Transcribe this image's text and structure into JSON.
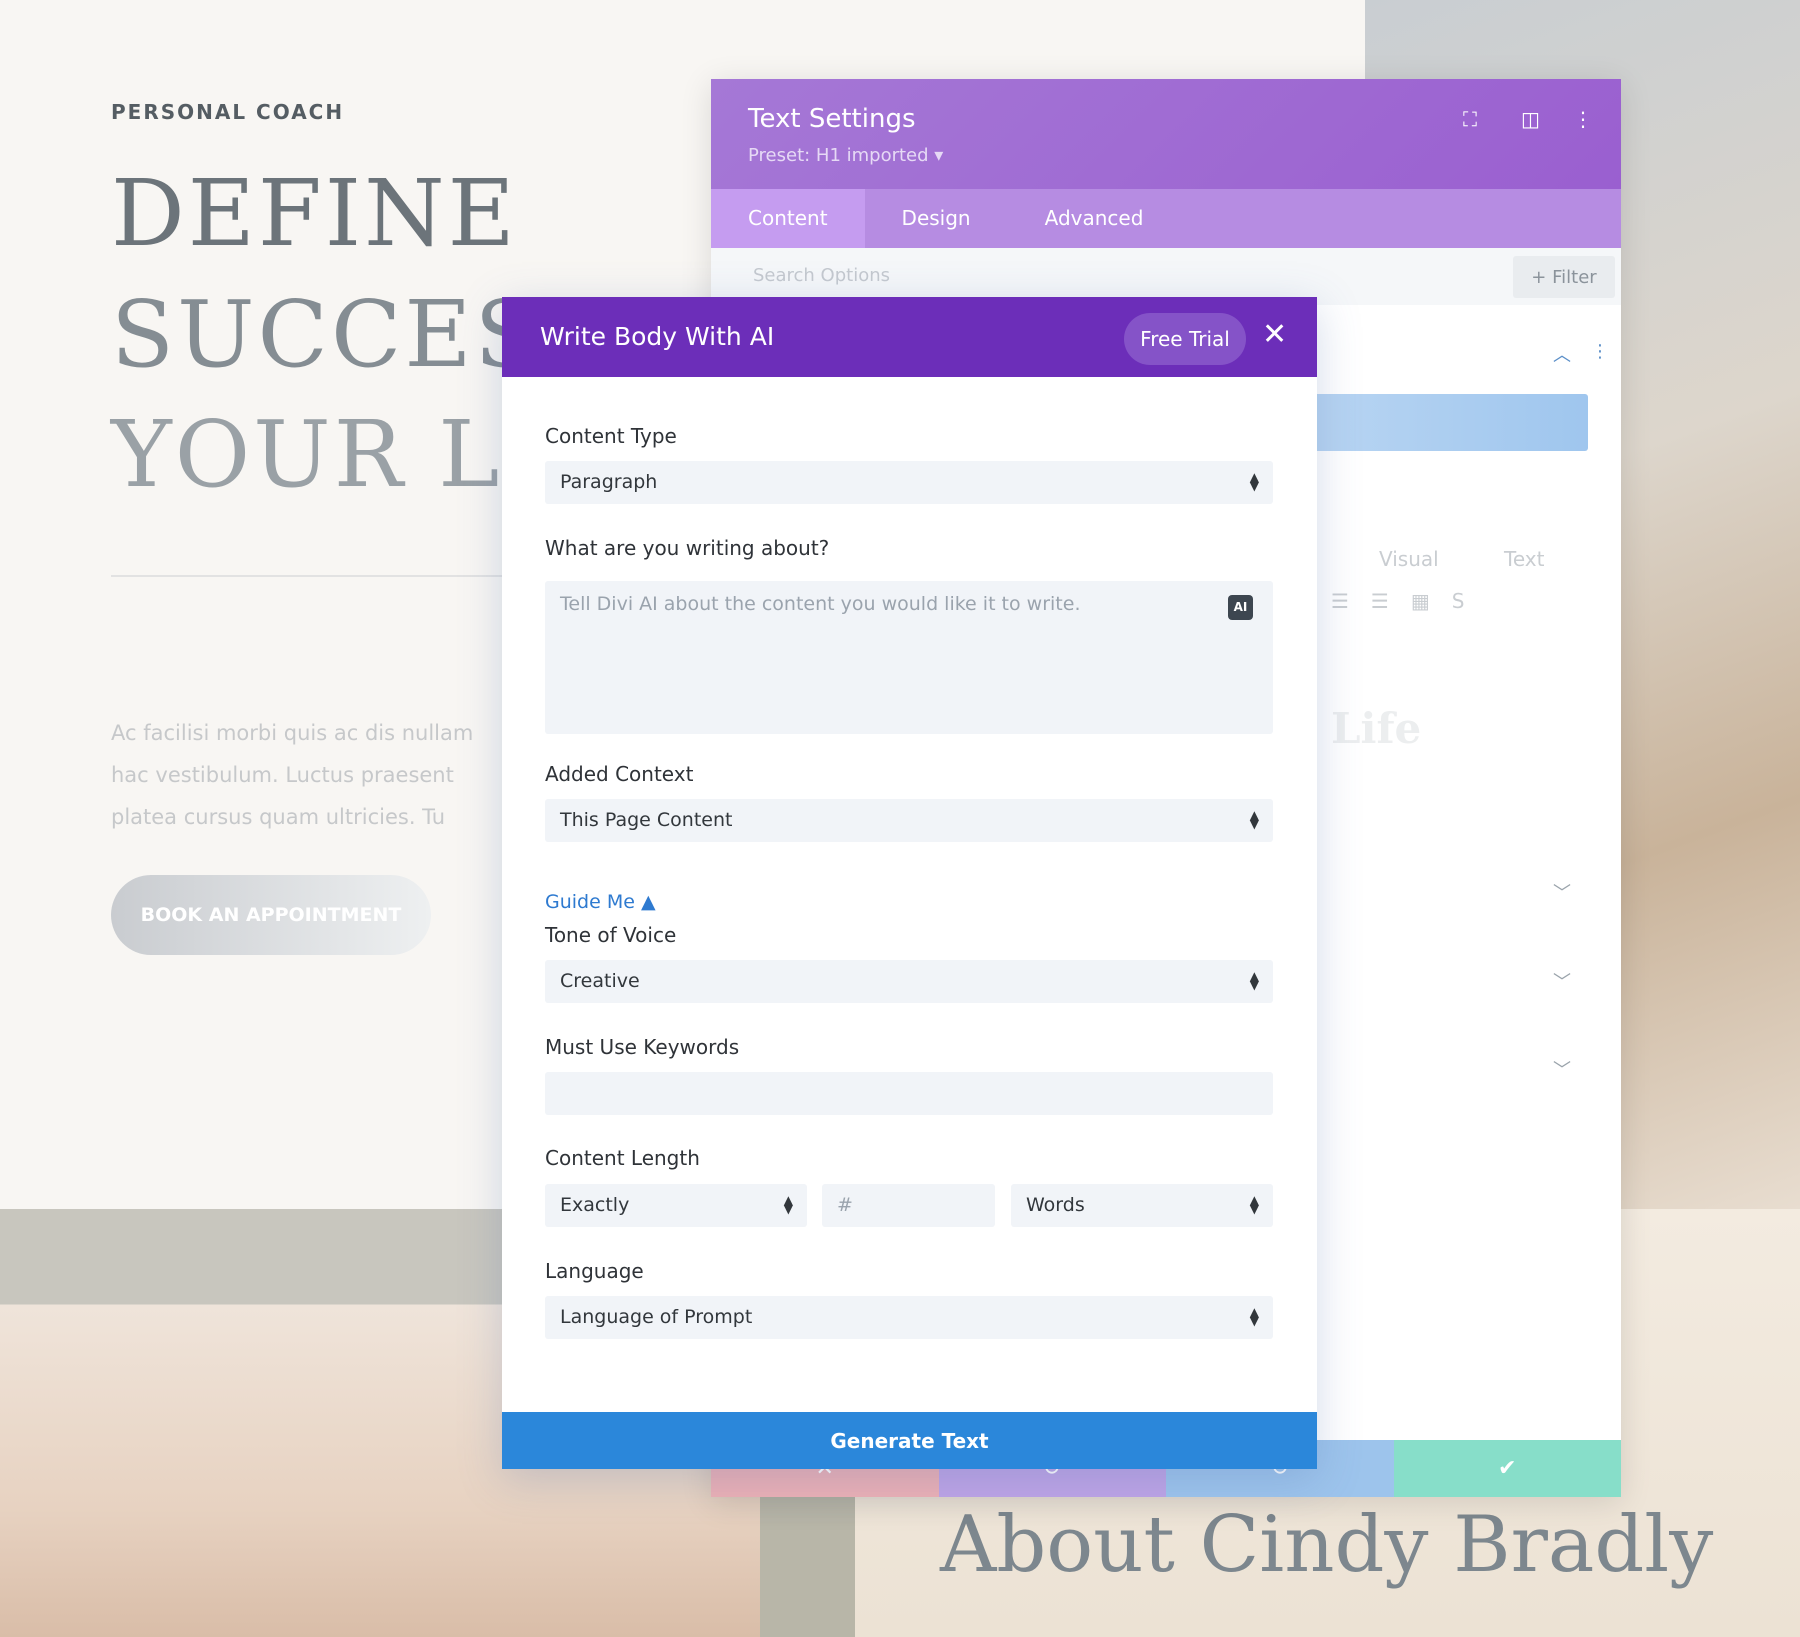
{
  "page": {
    "eyebrow": "PERSONAL COACH",
    "hero_lines": [
      "DEFINE",
      "SUCCESS",
      "YOUR LIFE"
    ],
    "paragraph_lines": [
      "Ac facilisi morbi quis ac dis nullam",
      "hac vestibulum. Luctus praesent",
      "platea cursus quam ultricies. Tu"
    ],
    "book_button": "BOOK AN APPOINTMENT",
    "about_heading": "About Cindy Bradly"
  },
  "settings_panel": {
    "title": "Text Settings",
    "preset": "Preset: H1 imported ▾",
    "icons": [
      "fullscreen-icon",
      "split-view-icon",
      "more-vertical-icon"
    ],
    "tabs": [
      {
        "label": "Content",
        "active": true
      },
      {
        "label": "Design"
      },
      {
        "label": "Advanced"
      }
    ],
    "search_placeholder": "Search Options",
    "filter_label": "+ Filter",
    "editor_tabs": [
      "Visual",
      "Text"
    ],
    "preview_text": "Life",
    "footer_colors": [
      "#ecb0b5",
      "#bea4e6",
      "#9dc4ec",
      "#87dec9"
    ],
    "footer_confirm": "✔"
  },
  "modal": {
    "title": "Write Body With AI",
    "free_trial": "Free Trial",
    "close": "✕",
    "content_type": {
      "label": "Content Type",
      "value": "Paragraph"
    },
    "topic": {
      "label": "What are you writing about?",
      "placeholder": "Tell Divi AI about the content you would like it to write.",
      "ai_badge": "AI"
    },
    "added_context": {
      "label": "Added Context",
      "value": "This Page Content"
    },
    "guide_me": "Guide Me ▲",
    "tone": {
      "label": "Tone of Voice",
      "value": "Creative"
    },
    "keywords": {
      "label": "Must Use Keywords",
      "value": ""
    },
    "length": {
      "label": "Content Length",
      "mode": "Exactly",
      "number_placeholder": "#",
      "unit": "Words"
    },
    "language": {
      "label": "Language",
      "value": "Language of Prompt"
    },
    "generate": "Generate Text"
  }
}
